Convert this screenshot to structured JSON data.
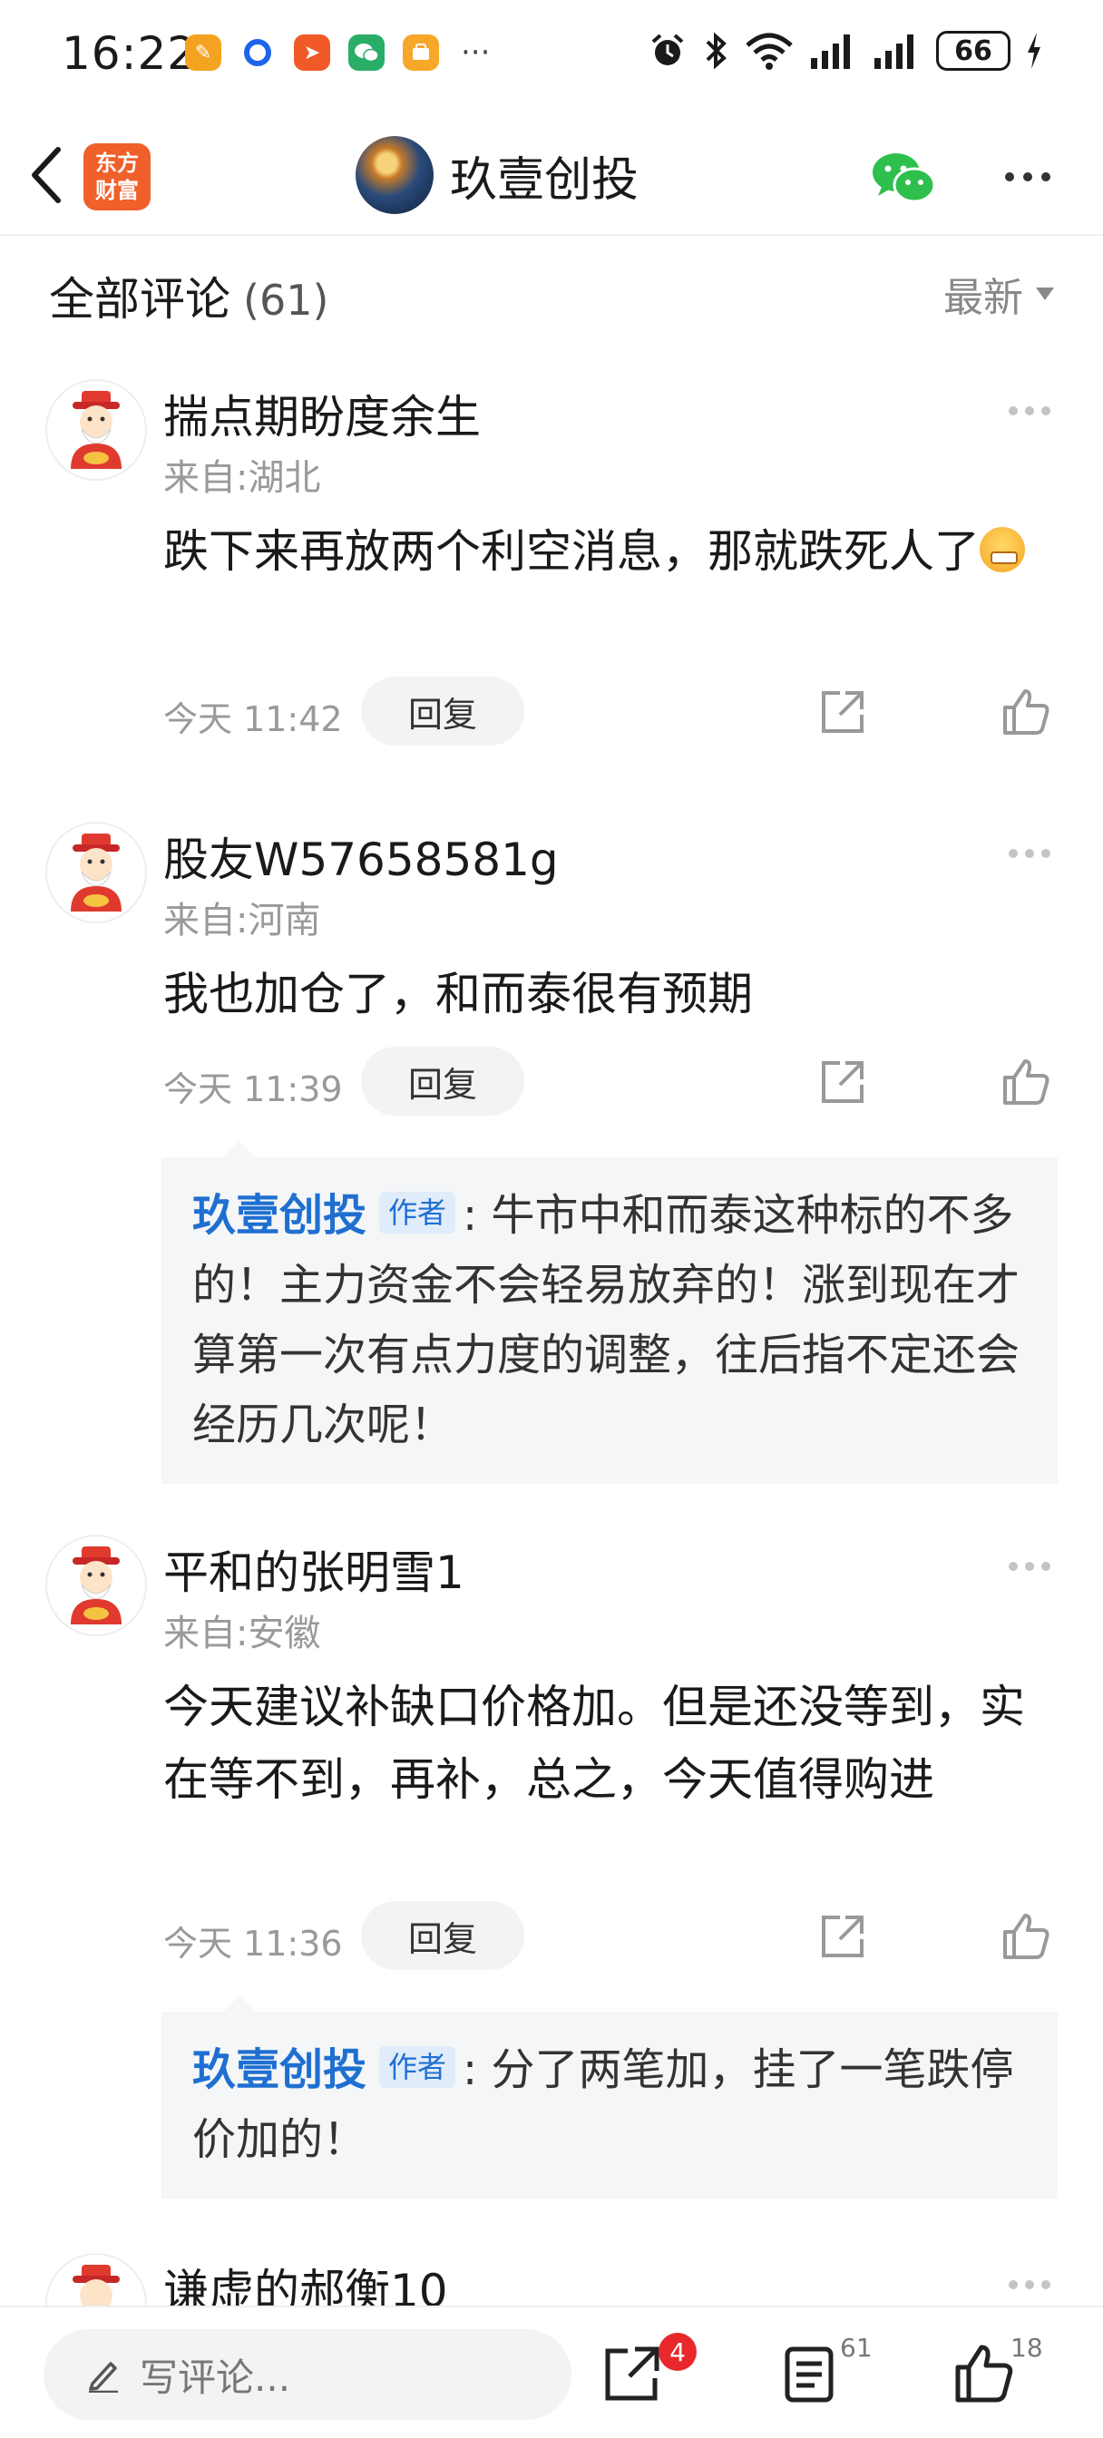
{
  "status_bar": {
    "time": "16:22",
    "more": "···",
    "battery": "66",
    "notification_icons": [
      {
        "name": "app-orange-icon",
        "color": "#f4a321"
      },
      {
        "name": "app-blue-icon",
        "color": "#1e63e9"
      },
      {
        "name": "app-red-icon",
        "color": "#f05a28"
      },
      {
        "name": "wechat-icon",
        "color": "#2aae67"
      },
      {
        "name": "app-yellow-icon",
        "color": "#f7a72a"
      }
    ]
  },
  "nav": {
    "logo_line1": "东方",
    "logo_line2": "财富",
    "title": "玖壹创投"
  },
  "comments_header": {
    "label": "全部评论",
    "count": "(61)",
    "sort": "最新"
  },
  "comments": [
    {
      "username": "揣点期盼度余生",
      "location": "来自:湖北",
      "text": "跌下来再放两个利空消息，那就跌死人了",
      "time": "今天 11:42",
      "reply_label": "回复"
    },
    {
      "username": "股友W57658581g",
      "location": "来自:河南",
      "text": "我也加仓了，和而泰很有预期",
      "time": "今天 11:39",
      "reply_label": "回复",
      "sub_reply": {
        "name": "玖壹创投",
        "tag": "作者",
        "text": ": 牛市中和而泰这种标的不多的！主力资金不会轻易放弃的！涨到现在才算第一次有点力度的调整，往后指不定还会经历几次呢！"
      }
    },
    {
      "username": "平和的张明雪1",
      "location": "来自:安徽",
      "text": "今天建议补缺口价格加。但是还没等到，实在等不到，再补，总之，今天值得购进",
      "time": "今天 11:36",
      "reply_label": "回复",
      "sub_reply": {
        "name": "玖壹创投",
        "tag": "作者",
        "text": ": 分了两笔加，挂了一笔跌停价加的！"
      }
    },
    {
      "username": "谦虚的郝衡10"
    }
  ],
  "bottom_bar": {
    "placeholder": "写评论...",
    "share_badge": "4",
    "comment_count": "61",
    "like_count": "18"
  }
}
